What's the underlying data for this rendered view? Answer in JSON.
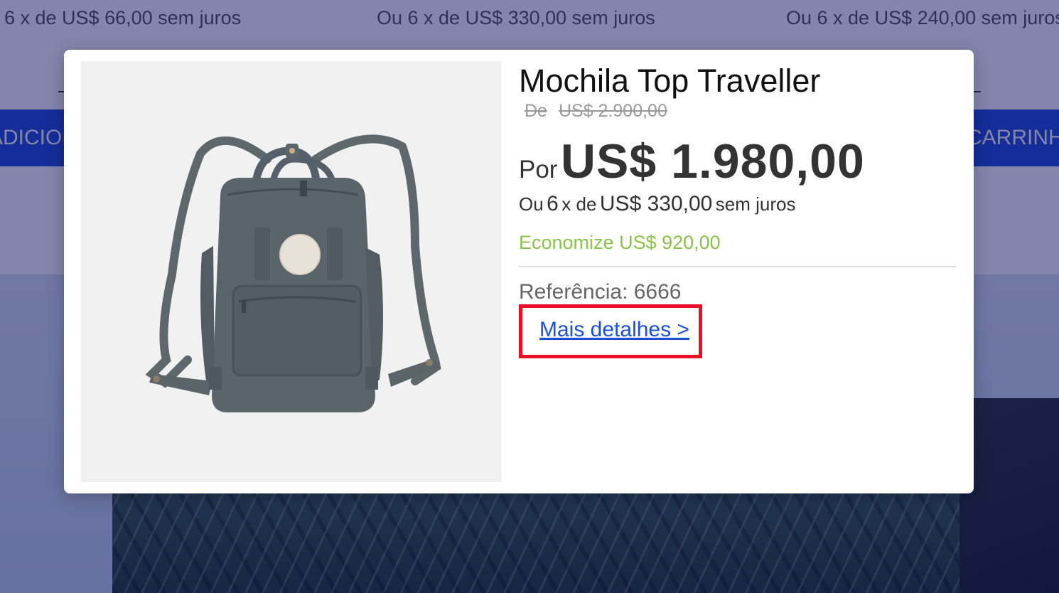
{
  "background": {
    "installments": [
      "6 x de US$ 66,00 sem juros",
      "Ou 6 x de US$ 330,00 sem juros",
      "Ou 6 x de US$ 240,00 sem juros"
    ],
    "button_left_label": "ADICIONAR",
    "button_right_label": "CARRINHO"
  },
  "modal": {
    "title": "Mochila Top Traveller",
    "old_price_prefix": "De",
    "old_price_value": "US$ 2.900,00",
    "price_prefix": "Por",
    "price_value": "US$ 1.980,00",
    "installment": {
      "prefix": "Ou",
      "count": "6",
      "x_de": "x de",
      "value": "US$ 330,00",
      "suffix": "sem juros"
    },
    "savings": "Economize US$ 920,00",
    "reference": "Referência: 6666",
    "details_link": "Mais detalhes >",
    "image_icon": "backpack-image",
    "colors": {
      "overlay": "#0a0c5a80",
      "savings": "#8ac24a",
      "link": "#1a4fd8",
      "highlight_box": "#e8102a",
      "button_bg": "#1f4fd6"
    }
  }
}
